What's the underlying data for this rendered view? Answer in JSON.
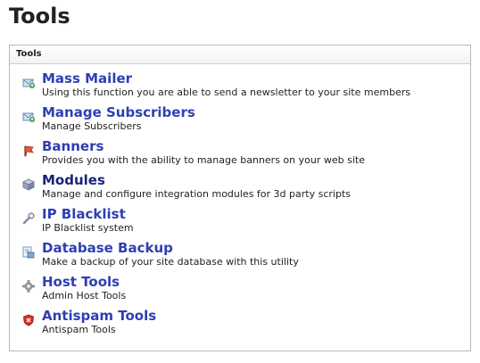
{
  "page": {
    "title": "Tools"
  },
  "panel": {
    "header": "Tools",
    "items": [
      {
        "label": "Mass Mailer",
        "description": "Using this function you are able to send a newsletter to your site members",
        "icon": "mail-envelope-icon"
      },
      {
        "label": "Manage Subscribers",
        "description": "Manage Subscribers",
        "icon": "mail-envelope-icon"
      },
      {
        "label": "Banners",
        "description": "Provides you with the ability to manage banners on your web site",
        "icon": "banner-flag-icon"
      },
      {
        "label": "Modules",
        "description": "Manage and configure integration modules for 3d party scripts",
        "icon": "module-cube-icon"
      },
      {
        "label": "IP Blacklist",
        "description": "IP Blacklist system",
        "icon": "wrench-icon"
      },
      {
        "label": "Database Backup",
        "description": "Make a backup of your site database with this utility",
        "icon": "database-backup-icon"
      },
      {
        "label": "Host Tools",
        "description": "Admin Host Tools",
        "icon": "gear-icon"
      },
      {
        "label": "Antispam Tools",
        "description": "Antispam Tools",
        "icon": "shield-icon"
      }
    ]
  },
  "colors": {
    "link": "#2d3fb3",
    "panel_border": "#b9b9b9",
    "text": "#222222"
  }
}
